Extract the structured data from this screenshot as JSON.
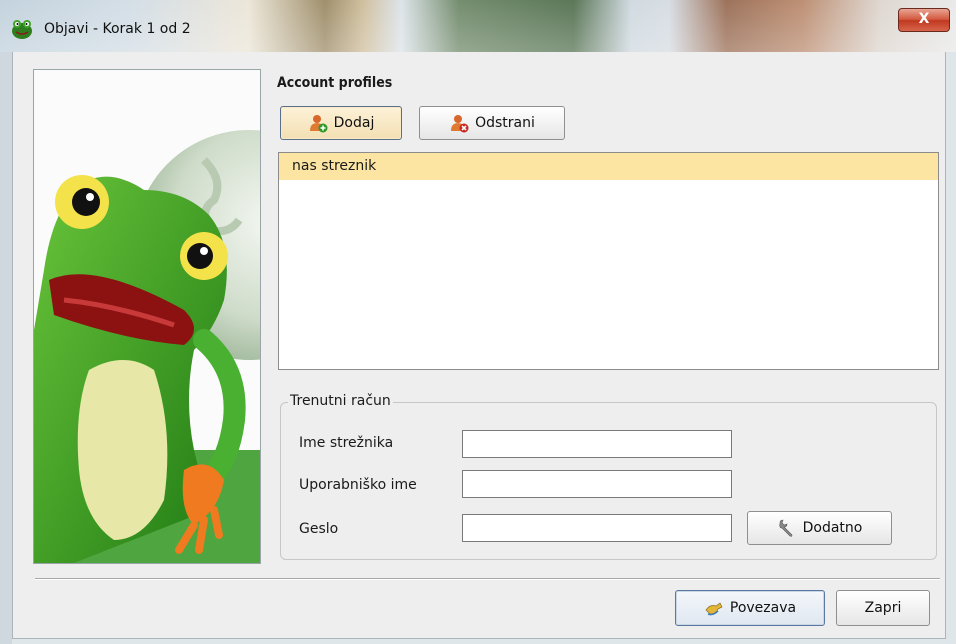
{
  "window": {
    "title": "Objavi - Korak 1 od 2",
    "close_label": "X"
  },
  "accounts": {
    "section_title": "Account profiles",
    "add_label": "Dodaj",
    "remove_label": "Odstrani",
    "items": [
      {
        "label": "nas streznik",
        "selected": true
      }
    ]
  },
  "current": {
    "legend": "Trenutni račun",
    "server_label": "Ime strežnika",
    "server_value": "",
    "username_label": "Uporabniško ime",
    "username_value": "",
    "password_label": "Geslo",
    "password_value": "",
    "advanced_label": "Dodatno"
  },
  "footer": {
    "connect_label": "Povezava",
    "close_label": "Zapri"
  },
  "colors": {
    "selection": "#fce5a3",
    "active_button": "#f3dfb3",
    "frog_green": "#3fa22c"
  },
  "icons": {
    "window": "frog-icon",
    "add": "user-add-icon",
    "remove": "user-remove-icon",
    "advanced": "wrench-icon",
    "connect": "connect-icon"
  }
}
